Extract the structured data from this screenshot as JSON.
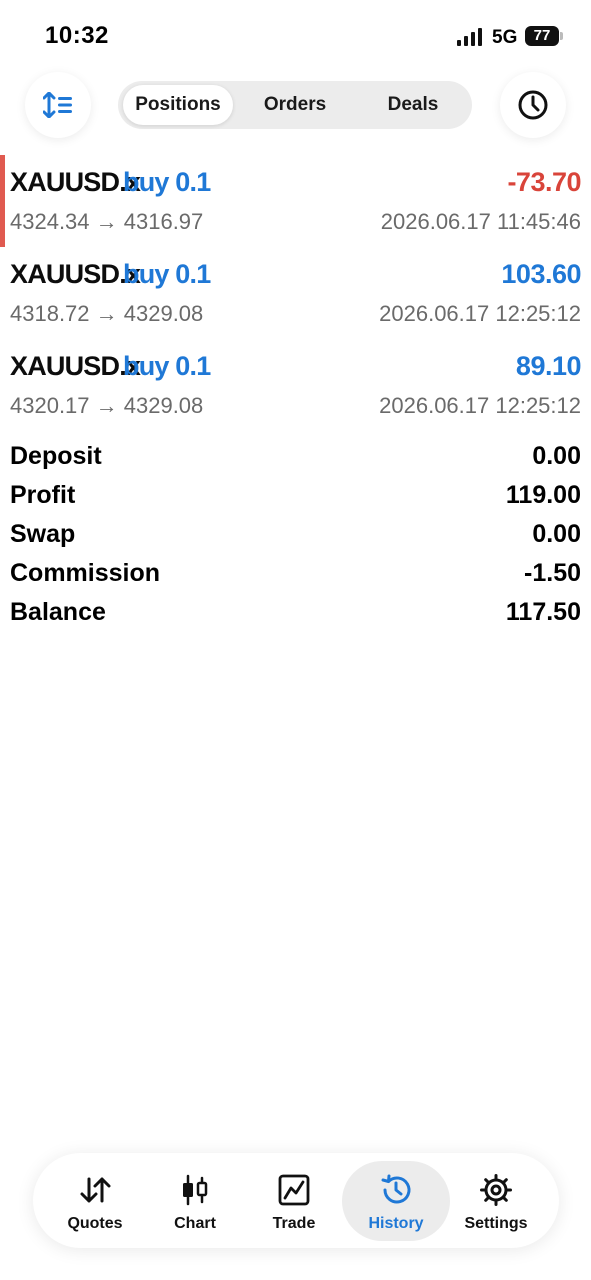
{
  "status_bar": {
    "time": "10:32",
    "network": "5G",
    "battery": "77"
  },
  "segments": [
    {
      "label": "Positions",
      "active": true
    },
    {
      "label": "Orders",
      "active": false
    },
    {
      "label": "Deals",
      "active": false
    }
  ],
  "deals": [
    {
      "symbol": "XAUUSD.x",
      "side": "buy 0.1",
      "profit": "-73.70",
      "prices": "4324.34 → 4316.97",
      "time": "2026.06.17 11:45:46"
    },
    {
      "symbol": "XAUUSD.x",
      "side": "buy 0.1",
      "profit": "103.60",
      "prices": "4318.72 → 4329.08",
      "time": "2026.06.17 12:25:12"
    },
    {
      "symbol": "XAUUSD.x",
      "side": "buy 0.1",
      "profit": "89.10",
      "prices": "4320.17 → 4329.08",
      "time": "2026.06.17 12:25:12"
    }
  ],
  "summary": [
    {
      "label": "Deposit",
      "value": "0.00"
    },
    {
      "label": "Profit",
      "value": "119.00"
    },
    {
      "label": "Swap",
      "value": "0.00"
    },
    {
      "label": "Commission",
      "value": "-1.50"
    },
    {
      "label": "Balance",
      "value": "117.50"
    }
  ],
  "tabs": [
    {
      "label": "Quotes",
      "icon": "quotes-arrows-icon"
    },
    {
      "label": "Chart",
      "icon": "candlestick-icon"
    },
    {
      "label": "Trade",
      "icon": "trade-chart-icon"
    },
    {
      "label": "History",
      "icon": "history-icon",
      "active": true
    },
    {
      "label": "Settings",
      "icon": "gear-icon"
    }
  ],
  "colors": {
    "accent": "#1f78d6",
    "loss": "#d9443a",
    "highlight_bar": "#e05a50"
  }
}
